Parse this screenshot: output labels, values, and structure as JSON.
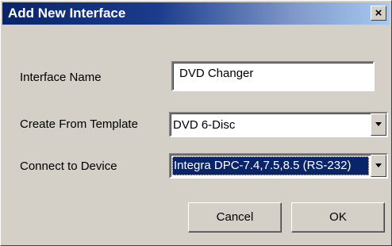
{
  "window": {
    "title": "Add New Interface",
    "close_glyph": "×"
  },
  "form": {
    "interface_name_label": "Interface Name",
    "interface_name_value": "DVD Changer",
    "template_label": "Create From Template",
    "template_value": "DVD 6-Disc",
    "device_label": "Connect to Device",
    "device_value": "Integra DPC-7.4,7.5,8.5 (RS-232)"
  },
  "buttons": {
    "cancel_label": "Cancel",
    "ok_label": "OK"
  },
  "colors": {
    "titlebar_start": "#0a246a",
    "titlebar_end": "#a6caf0",
    "dialog_face": "#d4d0c8",
    "selection": "#0a246a"
  },
  "icons": {
    "close": "close-icon",
    "dropdown": "chevron-down-icon"
  }
}
